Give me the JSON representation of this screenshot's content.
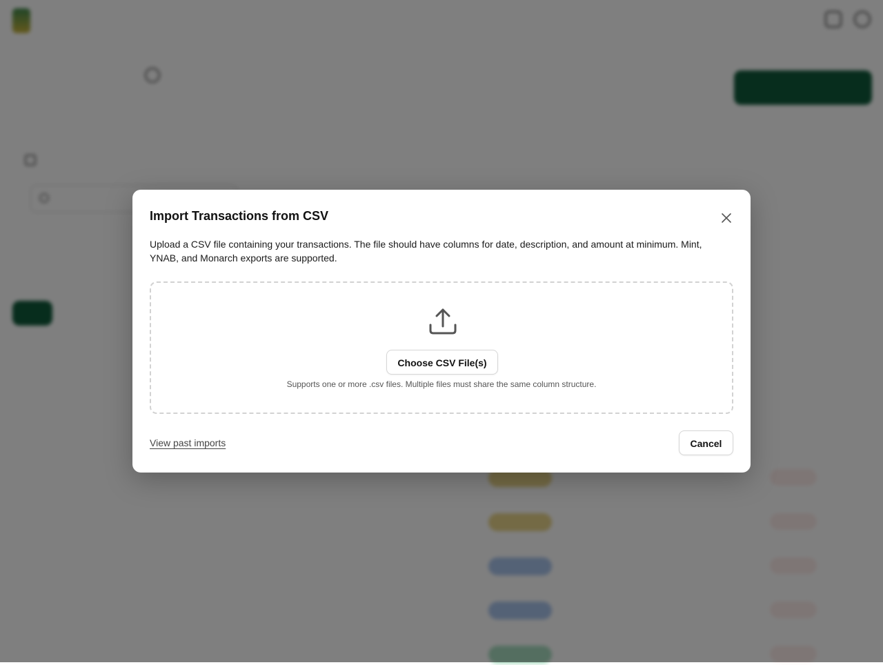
{
  "background": {
    "logo_text": "",
    "nav_items": [
      "",
      "",
      "",
      "",
      "",
      "",
      ""
    ],
    "page_title": "",
    "page_subtitle": "",
    "header_buttons": [
      "",
      ""
    ],
    "primary_button": "",
    "filters_title": "",
    "search_placeholder": "",
    "filter_button": "",
    "tabs": [
      "",
      ""
    ],
    "table_tools": [
      "",
      ""
    ],
    "column_headers": [
      "",
      ""
    ],
    "rows": [
      {
        "date": "",
        "merchant": "",
        "account": "",
        "category": "",
        "category_color": "#e8d48a",
        "amount": "",
        "status": ""
      },
      {
        "date": "",
        "merchant": "",
        "account": "",
        "category": "",
        "category_color": "#e8d48a",
        "amount": "",
        "status": ""
      },
      {
        "date": "",
        "merchant": "",
        "account": "",
        "category": "",
        "category_color": "#a9c4ec",
        "amount": "",
        "status": ""
      },
      {
        "date": "",
        "merchant": "",
        "account": "",
        "category": "",
        "category_color": "#a9c4ec",
        "amount": "",
        "status": ""
      },
      {
        "date": "",
        "merchant": "",
        "account": "",
        "category": "",
        "category_color": "#a8dcc0",
        "amount": "",
        "status": ""
      }
    ]
  },
  "modal": {
    "title": "Import Transactions from CSV",
    "description": "Upload a CSV file containing your transactions. The file should have columns for date, description, and amount at minimum. Mint, YNAB, and Monarch exports are supported.",
    "upload_icon": "upload-icon",
    "choose_button": "Choose CSV File(s)",
    "supports_text": "Supports one or more .csv files. Multiple files must share the same column structure.",
    "past_imports_link": "View past imports",
    "cancel_button": "Cancel",
    "close_icon": "close-icon"
  },
  "colors": {
    "brand_green": "#0f5a3a",
    "overlay": "#000000",
    "negative": "#c0392b"
  }
}
